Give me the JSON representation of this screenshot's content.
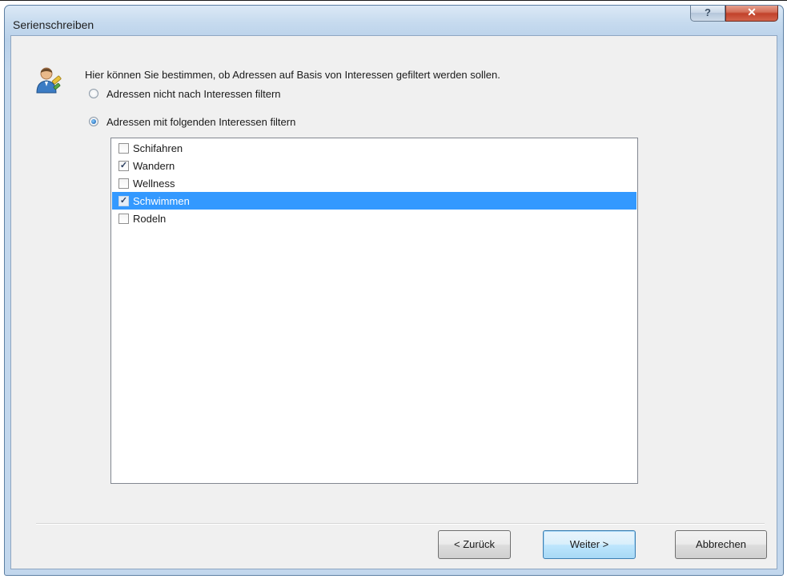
{
  "window": {
    "title": "Serienschreiben",
    "help_label": "?",
    "close_label": "✕"
  },
  "intro": {
    "text": "Hier können Sie bestimmen, ob Adressen auf Basis von Interessen gefiltert werden sollen."
  },
  "options": {
    "no_filter": {
      "label": "Adressen nicht nach Interessen filtern",
      "checked": false
    },
    "with_filter": {
      "label": "Adressen mit folgenden Interessen filtern",
      "checked": true
    }
  },
  "interests": [
    {
      "label": "Schifahren",
      "checked": false,
      "selected": false,
      "mark": ""
    },
    {
      "label": "Wandern",
      "checked": true,
      "selected": false,
      "mark": "✓"
    },
    {
      "label": "Wellness",
      "checked": false,
      "selected": false,
      "mark": ""
    },
    {
      "label": "Schwimmen",
      "checked": true,
      "selected": true,
      "mark": "✓"
    },
    {
      "label": "Rodeln",
      "checked": false,
      "selected": false,
      "mark": ""
    }
  ],
  "buttons": {
    "back": "< Zurück",
    "next": "Weiter >",
    "cancel": "Abbrechen"
  },
  "colors": {
    "selection": "#3399ff",
    "close_button": "#c2412a",
    "window_frame": "#b9d1ea"
  },
  "icons": {
    "dialog_icon": "person-icon"
  }
}
